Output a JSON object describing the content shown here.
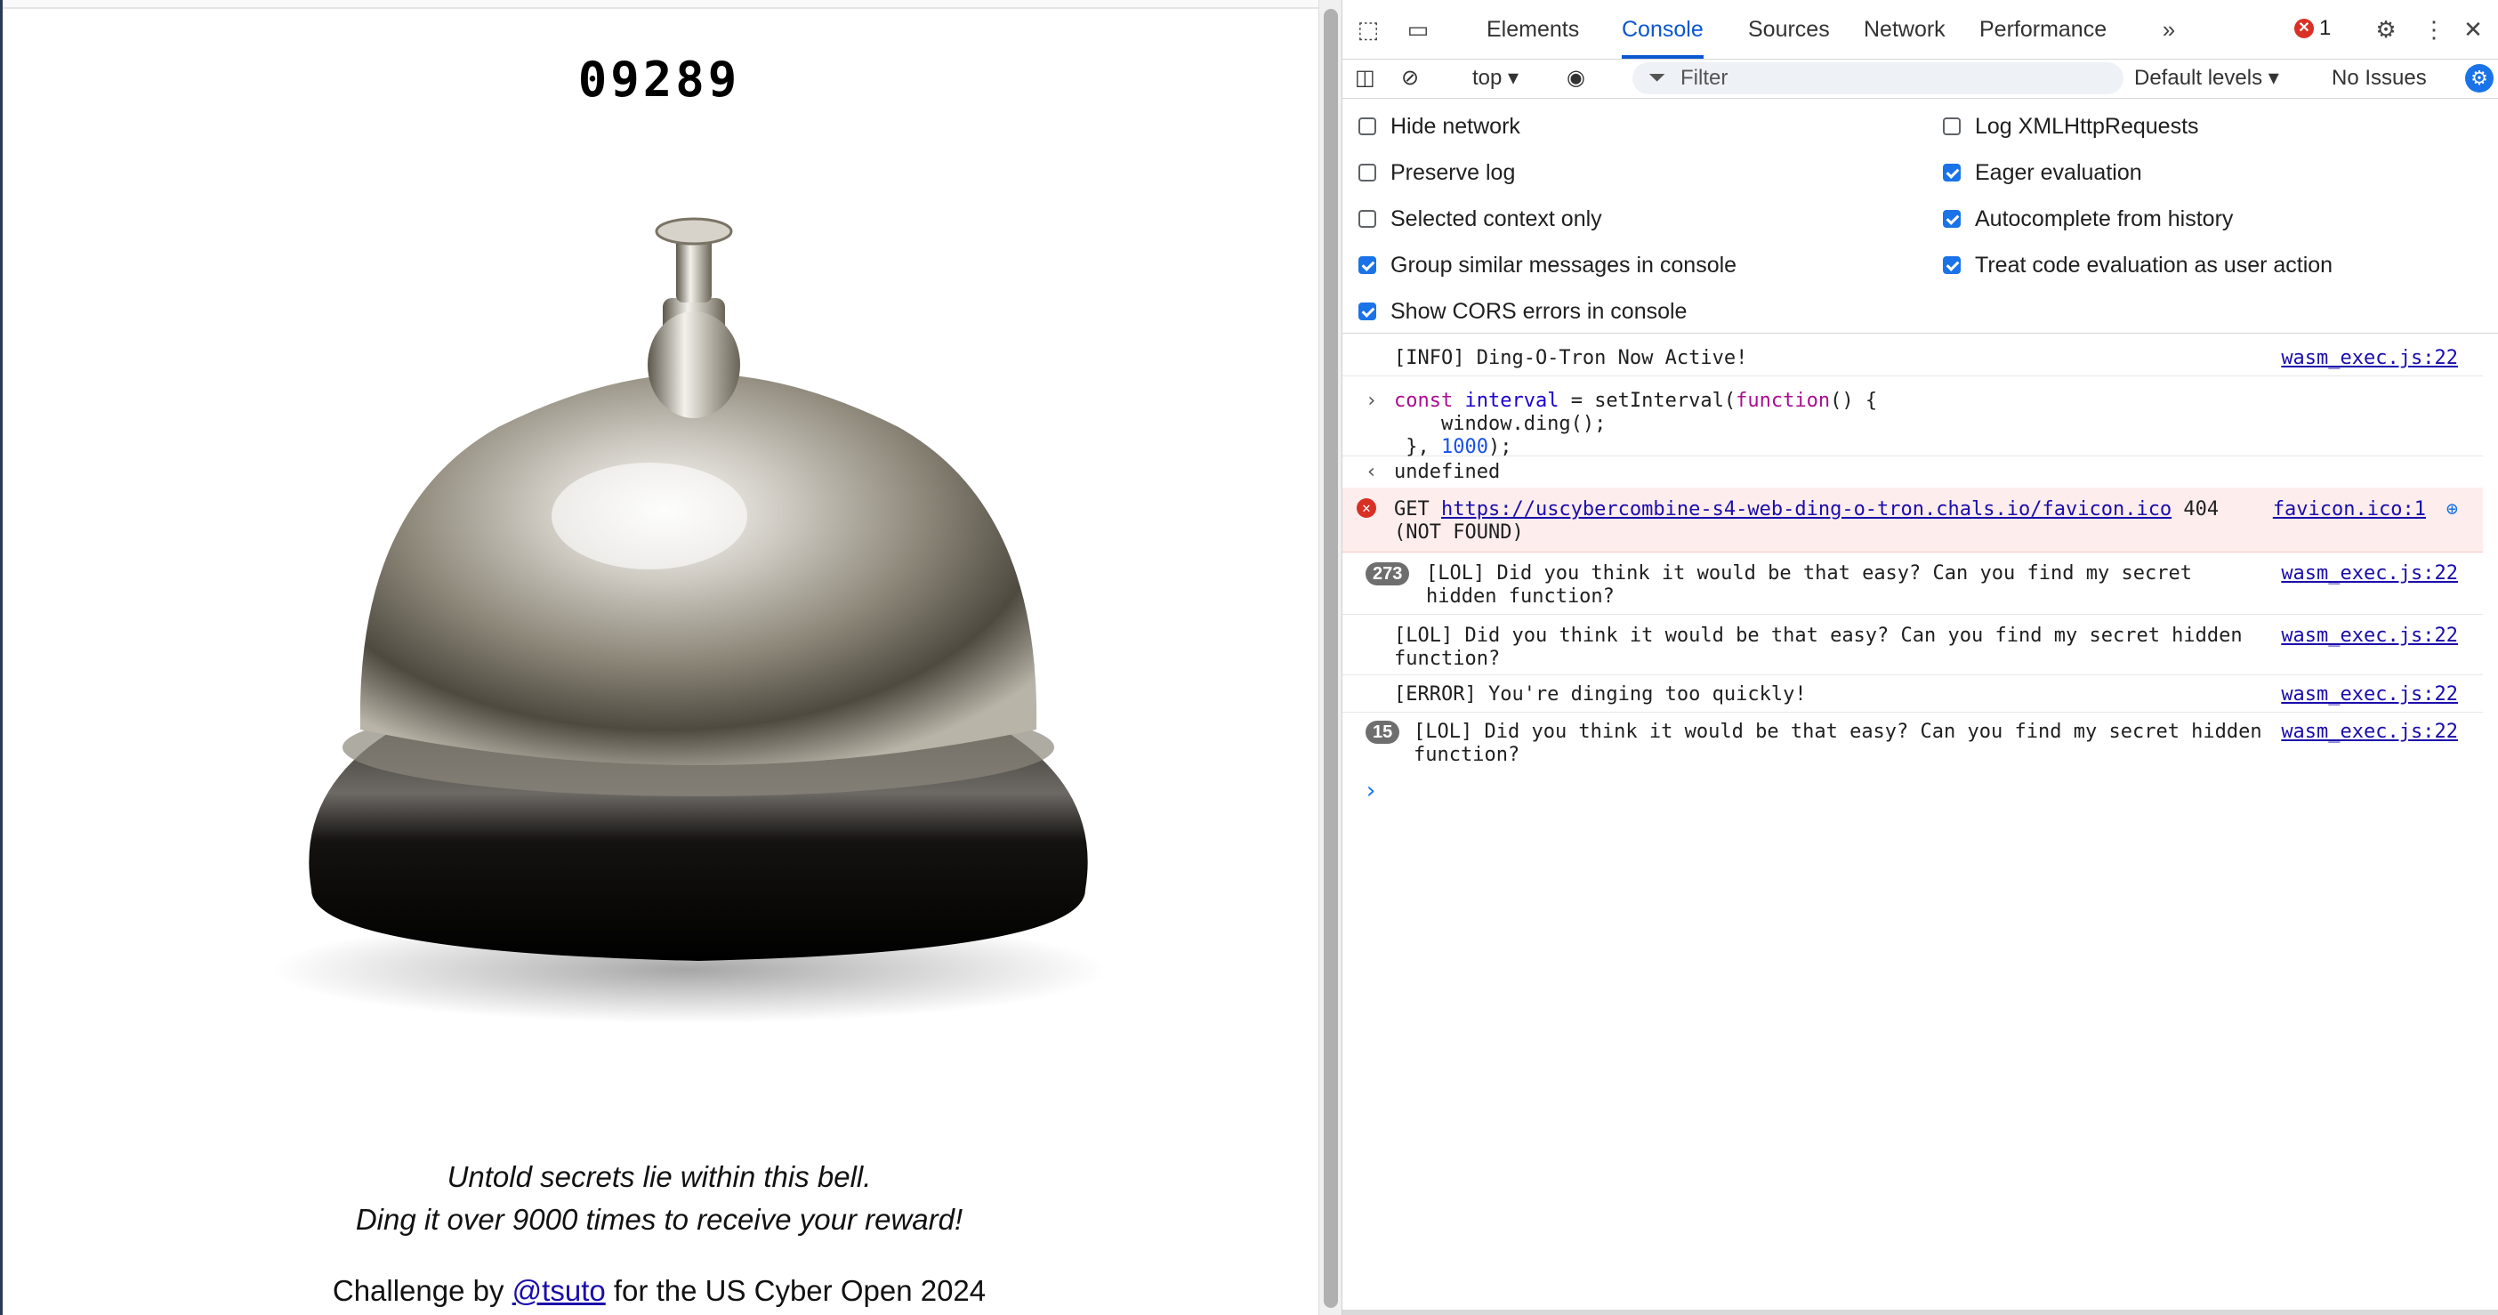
{
  "page": {
    "counter": "09289",
    "tagline_1": "Untold secrets lie within this bell.",
    "tagline_2": "Ding it over 9000 times to receive your reward!",
    "credit_prefix": "Challenge by ",
    "credit_link": "@tsuto",
    "credit_suffix": " for the US Cyber Open 2024"
  },
  "devtools": {
    "tabs": [
      "Elements",
      "Console",
      "Sources",
      "Network",
      "Performance"
    ],
    "active_tab": "Console",
    "more_tabs_icon": "chevron-double-right-icon",
    "error_count": "1",
    "toolbar": {
      "context": "top",
      "filter_placeholder": "Filter",
      "levels": "Default levels",
      "issues": "No Issues"
    },
    "settings": {
      "left": [
        {
          "label": "Hide network",
          "checked": false
        },
        {
          "label": "Preserve log",
          "checked": false
        },
        {
          "label": "Selected context only",
          "checked": false
        },
        {
          "label": "Group similar messages in console",
          "checked": true
        },
        {
          "label": "Show CORS errors in console",
          "checked": true
        }
      ],
      "right": [
        {
          "label": "Log XMLHttpRequests",
          "checked": false
        },
        {
          "label": "Eager evaluation",
          "checked": true
        },
        {
          "label": "Autocomplete from history",
          "checked": true
        },
        {
          "label": "Treat code evaluation as user action",
          "checked": true
        }
      ]
    },
    "console": {
      "info": "[INFO] Ding-O-Tron Now Active!",
      "info_src": "wasm_exec.js:22",
      "code_line1_kw": "const",
      "code_line1_var": "interval",
      "code_line1_mid": " = setInterval(",
      "code_line1_kw2": "function",
      "code_line1_end": "() {",
      "code_line2": "    window.ding();",
      "code_line3_start": "}, ",
      "code_line3_num": "1000",
      "code_line3_end": ");",
      "result": "undefined",
      "error_prefix": "GET ",
      "error_url": "https://uscybercombine-s4-web-ding-o-tron.chals.io/favicon.ico",
      "error_code": " 404",
      "error_line2": "(NOT FOUND)",
      "error_src": "favicon.ico:1",
      "lol1_count": "273",
      "lol1_line1": "[LOL] Did you think it would be that easy? Can you find my secret",
      "lol1_line2": "hidden function?",
      "lol1_src": "wasm_exec.js:22",
      "lol2_line1": "[LOL] Did you think it would be that easy? Can you find my secret hidden",
      "lol2_line2": "function?",
      "lol2_src": "wasm_exec.js:22",
      "err_msg": "[ERROR] You're dinging too quickly!",
      "err_msg_src": "wasm_exec.js:22",
      "lol3_count": "15",
      "lol3_line1": "[LOL] Did you think it would be that easy? Can you find my secret hidden",
      "lol3_line2": "function?",
      "lol3_src": "wasm_exec.js:22"
    }
  },
  "colors": {
    "accent": "#0b57d0",
    "error": "#d93025",
    "link": "#1a0dab"
  }
}
